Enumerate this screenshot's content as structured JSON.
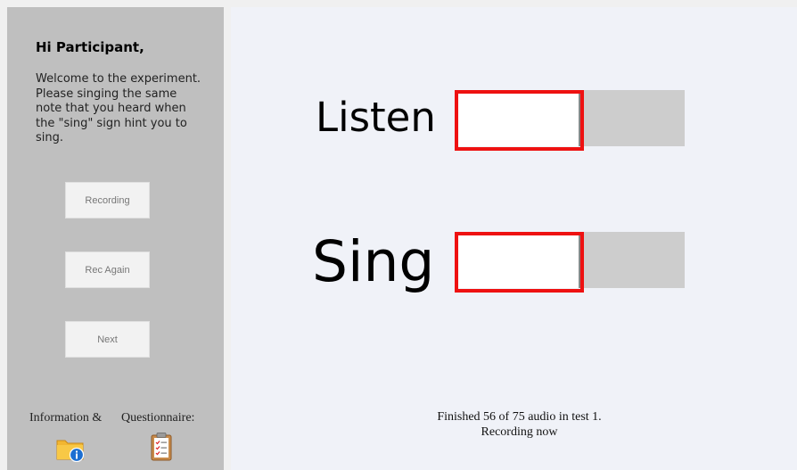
{
  "sidebar": {
    "greeting": "Hi Participant,",
    "intro_lines": [
      "Welcome to the experiment.",
      "Please singing the same",
      "note that you heard when",
      "the \"sing\" sign hint you to",
      "sing."
    ],
    "buttons": {
      "recording": "Recording",
      "rec_again": "Rec Again",
      "next": "Next"
    },
    "information_label": "Information &",
    "questionnaire_label": "Questionnaire:",
    "information_icon": "folder-info-icon",
    "questionnaire_icon": "clipboard-checklist-icon"
  },
  "main": {
    "listen_label": "Listen",
    "sing_label": "Sing",
    "listen_level": 0.55,
    "sing_level": 0.55,
    "status_line1": "Finished 56 of 75 audio in test 1.",
    "status_line2": "Recording now"
  },
  "colors": {
    "sidebar_bg": "#bfbfbf",
    "main_bg": "#f0f2f8",
    "highlight_frame": "#ee1111",
    "meter_track": "#cdcdcd"
  }
}
